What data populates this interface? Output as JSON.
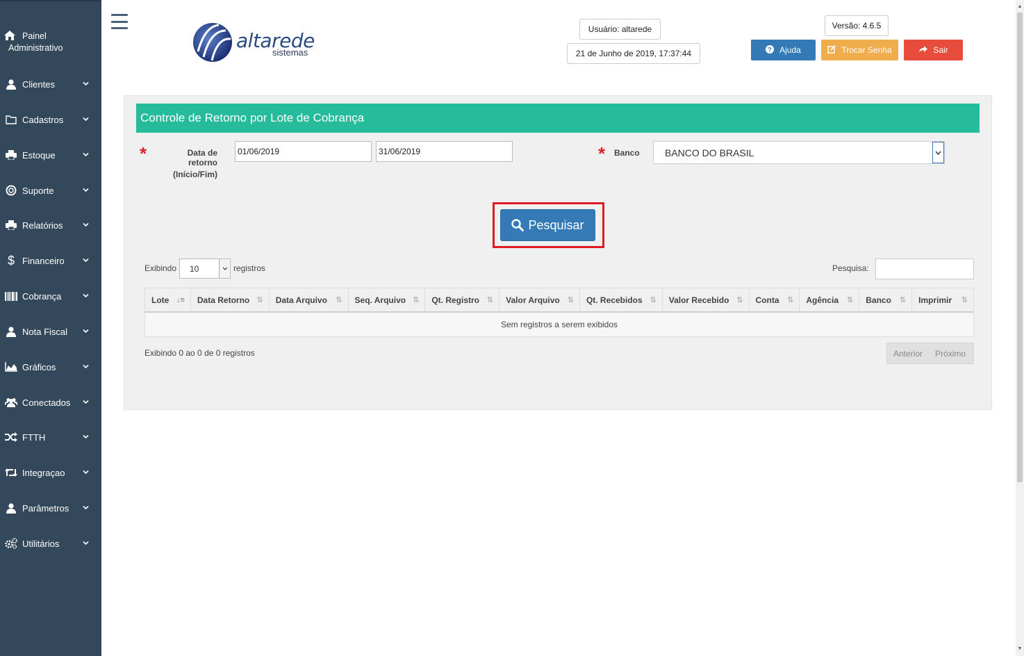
{
  "sidebar": {
    "admin_line1": "Painel",
    "admin_line2": "Administrativo",
    "items": [
      {
        "label": "Clientes",
        "icon": "user-icon"
      },
      {
        "label": "Cadastros",
        "icon": "folder-icon"
      },
      {
        "label": "Estoque",
        "icon": "printer-icon"
      },
      {
        "label": "Suporte",
        "icon": "lifebuoy-icon"
      },
      {
        "label": "Relatórios",
        "icon": "printer-icon"
      },
      {
        "label": "Financeiro",
        "icon": "dollar-icon"
      },
      {
        "label": "Cobrança",
        "icon": "barcode-icon"
      },
      {
        "label": "Nota Fiscal",
        "icon": "user-icon"
      },
      {
        "label": "Gráficos",
        "icon": "area-chart-icon"
      },
      {
        "label": "Conectados",
        "icon": "users-icon"
      },
      {
        "label": "FTTH",
        "icon": "random-icon"
      },
      {
        "label": "Integraçao",
        "icon": "retweet-icon"
      },
      {
        "label": "Parâmetros",
        "icon": "user-icon"
      },
      {
        "label": "Utilitários",
        "icon": "cogs-icon"
      }
    ]
  },
  "header": {
    "logo_text": "altarede",
    "logo_sub": "sistemas",
    "user": "Usuário: altarede",
    "datetime": "21 de Junho de 2019, 17:37:44",
    "version": "Versão: 4.6.5",
    "help_label": "Ajuda",
    "change_password_label": "Trocar Senha",
    "exit_label": "Sair"
  },
  "form": {
    "title": "Controle de Retorno por Lote de Cobrança",
    "date_label_1": "Data de retorno",
    "date_label_2": "(Início/Fim)",
    "date_start": "01/06/2019",
    "date_end": "31/06/2019",
    "bank_label": "Banco",
    "bank_value": "BANCO DO BRASIL",
    "search_button": "Pesquisar"
  },
  "table": {
    "show_label": "Exibindo",
    "page_size": "10",
    "records_label": "registros",
    "search_label": "Pesquisa:",
    "columns": [
      "Lote",
      "Data Retorno",
      "Data Arquivo",
      "Seq. Arquivo",
      "Qt. Registro",
      "Valor Arquivo",
      "Qt. Recebidos",
      "Valor Recebido",
      "Conta",
      "Agência",
      "Banco",
      "Imprimir"
    ],
    "empty_message": "Sem registros a serem exibidos",
    "info": "Exibindo 0 ao 0 de 0 registros",
    "prev_label": "Anterior",
    "next_label": "Próximo"
  },
  "colors": {
    "sidebar_bg": "#34485b",
    "title_bar": "#26bb9a",
    "primary": "#337ab7",
    "warning": "#f0ad4e",
    "danger": "#e74c3c",
    "highlight": "#e01a22"
  }
}
